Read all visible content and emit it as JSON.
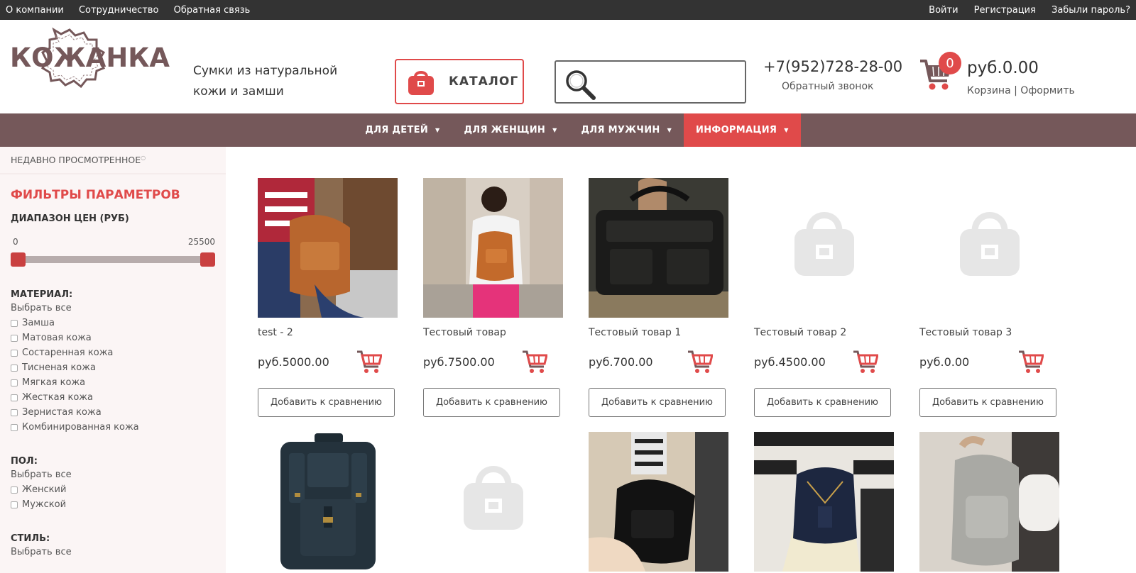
{
  "topbar": {
    "left": [
      "О компании",
      "Сотрудничество",
      "Обратная связь"
    ],
    "right": [
      "Войти",
      "Регистрация",
      "Забыли пароль?"
    ]
  },
  "header": {
    "logo_text": "КОЖАНКА",
    "slogan_line1": "Сумки из натуральной",
    "slogan_line2": "кожи и замши",
    "catalog_label": "КАТАЛОГ",
    "search_placeholder": "",
    "phone": "+7(952)728-28-00",
    "callback": "Обратный звонок",
    "cart_count": "0",
    "cart_total": "руб.0.00",
    "cart_link": "Корзина",
    "cart_separator": "|",
    "checkout_link": "Оформить"
  },
  "nav": [
    {
      "label": "ДЛЯ ДЕТЕЙ"
    },
    {
      "label": "ДЛЯ ЖЕНЩИН"
    },
    {
      "label": "ДЛЯ МУЖЧИН"
    },
    {
      "label": "ИНФОРМАЦИЯ",
      "active": true
    }
  ],
  "sidebar": {
    "recent": "НЕДАВНО ПРОСМОТРЕННОЕ",
    "filters_title": "ФИЛЬТРЫ ПАРАМЕТРОВ",
    "price_title": "ДИАПАЗОН ЦЕН (РУБ)",
    "price_min": "0",
    "price_max": "25500",
    "groups": [
      {
        "title": "МАТЕРИАЛ:",
        "select_all": "Выбрать все",
        "options": [
          "Замша",
          "Матовая кожа",
          "Состаренная кожа",
          "Тисненая кожа",
          "Мягкая кожа",
          "Жесткая кожа",
          "Зернистая кожа",
          "Комбинированная кожа"
        ]
      },
      {
        "title": "ПОЛ:",
        "select_all": "Выбрать все",
        "options": [
          "Женский",
          "Мужской"
        ]
      },
      {
        "title": "СТИЛЬ:",
        "select_all": "Выбрать все",
        "options": []
      }
    ]
  },
  "products": [
    {
      "name": "test - 2",
      "price": "руб.5000.00",
      "compare": "Добавить к сравнению",
      "image": "brown-backpack-photo"
    },
    {
      "name": "Тестовый товар",
      "price": "руб.7500.00",
      "compare": "Добавить к сравнению",
      "image": "woman-orange-backpack-photo"
    },
    {
      "name": "Тестовый товар 1",
      "price": "руб.700.00",
      "compare": "Добавить к сравнению",
      "image": "black-duffel-bag-photo"
    },
    {
      "name": "Тестовый товар 2",
      "price": "руб.4500.00",
      "compare": "Добавить к сравнению",
      "image": "placeholder-bag-icon"
    },
    {
      "name": "Тестовый товар 3",
      "price": "руб.0.00",
      "compare": "Добавить к сравнению",
      "image": "placeholder-bag-icon"
    }
  ],
  "products_row2": [
    {
      "image": "dark-leather-backpack-photo"
    },
    {
      "image": "placeholder-bag-icon"
    },
    {
      "image": "black-backpack-photo"
    },
    {
      "image": "navy-mini-backpack-photo"
    },
    {
      "image": "grey-backpack-photo"
    }
  ],
  "colors": {
    "accent": "#e04a4a",
    "nav": "#75585a",
    "topbar": "#333333"
  }
}
